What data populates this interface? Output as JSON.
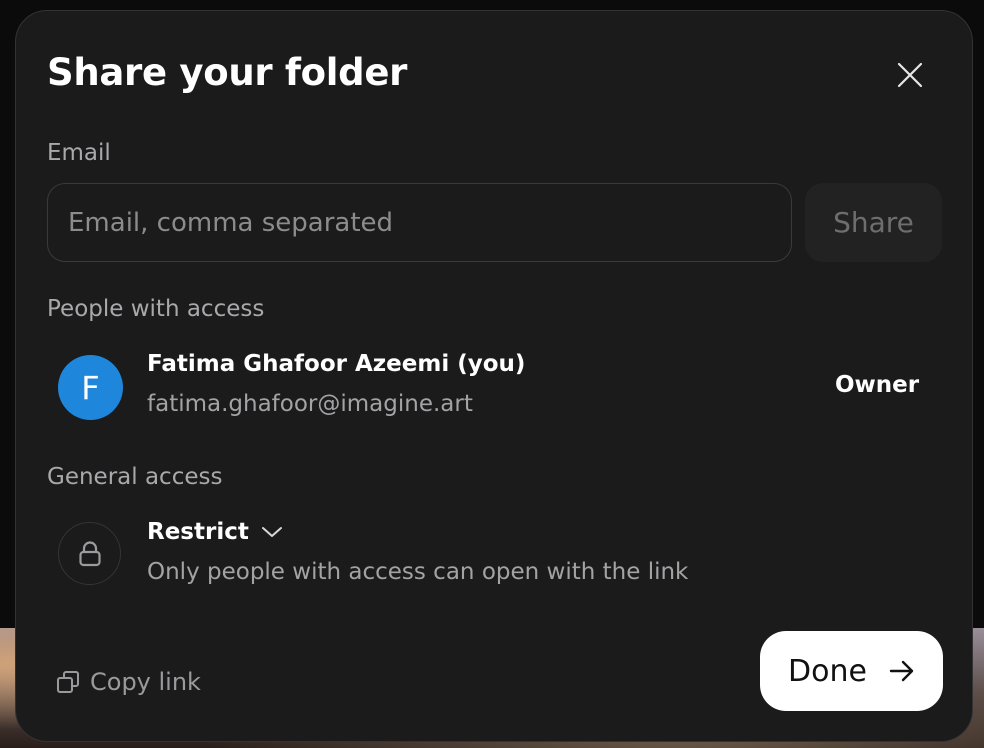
{
  "dialog": {
    "title": "Share your folder",
    "close_icon": "close-icon"
  },
  "email": {
    "label": "Email",
    "value": "",
    "placeholder": "Email, comma separated",
    "share_label": "Share"
  },
  "people": {
    "label": "People with access",
    "items": [
      {
        "avatar_initial": "F",
        "avatar_color": "#1f87db",
        "name": "Fatima Ghafoor Azeemi (you)",
        "email": "fatima.ghafoor@imagine.art",
        "role": "Owner"
      }
    ]
  },
  "general_access": {
    "label": "General access",
    "icon": "lock-icon",
    "selected": "Restrict",
    "description": "Only people with access can open with the link"
  },
  "footer": {
    "copy_link_label": "Copy link",
    "copy_icon": "copy-icon",
    "done_label": "Done",
    "done_icon": "arrow-right-icon"
  },
  "colors": {
    "dialog_background": "#1b1b1c",
    "avatar_blue": "#1f87db",
    "primary_button": "#ffffff"
  }
}
